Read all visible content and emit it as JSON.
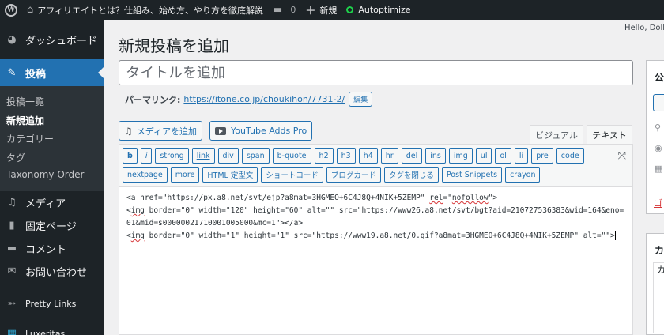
{
  "admin_bar": {
    "site_name": "アフィリエイトとは？仕組み、始め方、やり方を徹底解説",
    "comments_count": "0",
    "new_label": "新規",
    "autoptimize_label": "Autoptimize",
    "greeting": "Hello, Dolly"
  },
  "sidebar": {
    "dashboard": "ダッシュボード",
    "posts": "投稿",
    "posts_sub": [
      "投稿一覧",
      "新規追加",
      "カテゴリー",
      "タグ",
      "Taxonomy Order"
    ],
    "media": "メディア",
    "pages": "固定ページ",
    "comments": "コメント",
    "contact": "お問い合わせ",
    "pretty_links": "Pretty Links",
    "luxeritas": "Luxeritas"
  },
  "main": {
    "page_title": "新規投稿を追加",
    "title_placeholder": "タイトルを追加",
    "permalink_label": "パーマリンク:",
    "permalink_url": "https://itone.co.jp/choukihon/7731-2/",
    "permalink_edit": "編集",
    "add_media": "メディアを追加",
    "youtube_adds": "YouTube Adds Pro",
    "tab_visual": "ビジュアル",
    "tab_text": "テキスト",
    "quicktags_row1": [
      "b",
      "i",
      "strong",
      "link",
      "div",
      "span",
      "b-quote",
      "h2",
      "h3",
      "h4",
      "hr",
      "del",
      "ins",
      "img",
      "ul",
      "ol",
      "li",
      "pre",
      "code"
    ],
    "quicktags_row2": [
      "nextpage",
      "more",
      "HTML 定型文",
      "ショートコード",
      "ブログカード",
      "タグを閉じる",
      "Post Snippets",
      "crayon"
    ]
  },
  "code": {
    "l1a": "<a href=\"https://px.a8.net/svt/ejp?a8mat=3HGMEO+6C4J8Q+4NIK+5ZEMP\" ",
    "l1b": "rel",
    "l1c": "=\"",
    "l1d": "nofollow",
    "l1e": "\">",
    "l2a": "<",
    "l2b": "img",
    "l2c": " border=\"0\" width=\"120\" height=\"60\" alt=\"\" src=\"https://www26.a8.net/svt/bgt?aid=210727536383&wid=164&eno=01&mid=s00000021710001005000&mc=1\"></a>",
    "l3a": "<",
    "l3b": "img",
    "l3c": " border=\"0\" width=\"1\" height=\"1\" src=\"https://www19.a8.net/0.gif?a8mat=3HGMEO+6C4J8Q+4NIK+5ZEMP\" alt=\"\">"
  },
  "right": {
    "publish_title": "公",
    "publish_link": "ゴ",
    "category_title": "カ",
    "category_inner": "カ"
  },
  "icons": {
    "wp": "wordpress-icon",
    "home": "home-icon",
    "comment": "comment-icon",
    "plus": "plus-icon"
  }
}
